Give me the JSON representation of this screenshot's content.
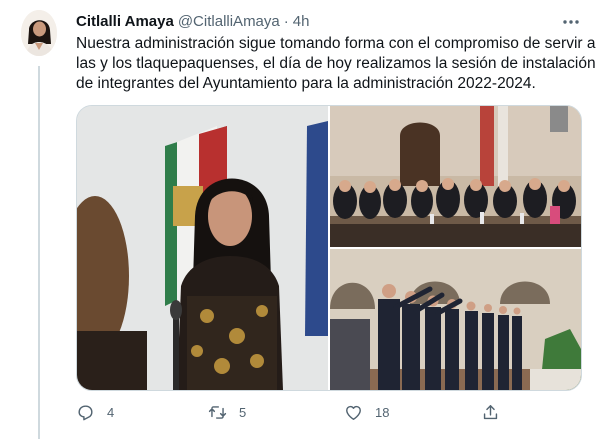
{
  "tweet": {
    "author": {
      "display_name": "Citlalli Amaya",
      "handle": "@CitlalliAmaya",
      "separator": "·",
      "timestamp": "4h"
    },
    "text_lines": [
      "Nuestra administración sigue tomando forma con el compromiso de servir a",
      "las y los tlaquepaquenses, el día de hoy realizamos la sesión de instalación",
      "de integrantes del Ayuntamiento para la administración 2022-2024."
    ],
    "media": [
      {
        "icon": "photo-woman-taking-oath"
      },
      {
        "icon": "photo-council-session-table"
      },
      {
        "icon": "photo-members-raising-hands"
      }
    ],
    "actions": {
      "reply": {
        "icon": "reply-icon",
        "count": "4"
      },
      "retweet": {
        "icon": "retweet-icon",
        "count": "5"
      },
      "like": {
        "icon": "heart-icon",
        "count": "18"
      },
      "share": {
        "icon": "share-icon",
        "count": ""
      }
    }
  },
  "colors": {
    "text_primary": "#0f1419",
    "text_secondary": "#536471",
    "border": "#cfd9de"
  }
}
